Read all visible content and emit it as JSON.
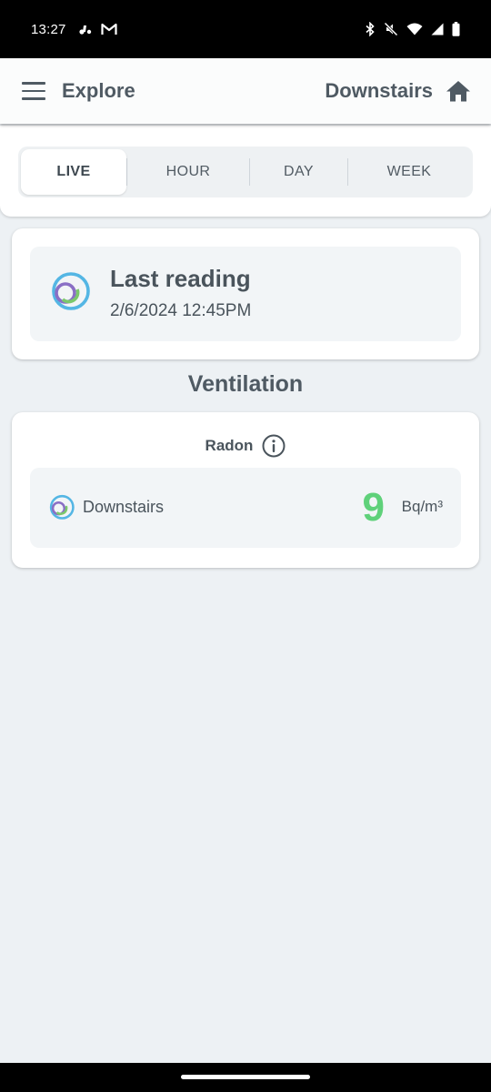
{
  "status_bar": {
    "time": "13:27",
    "left_icons": [
      "notification-dots-icon",
      "gmail-icon"
    ],
    "right_icons": [
      "bluetooth-icon",
      "mute-icon",
      "wifi-icon",
      "signal-icon",
      "battery-icon"
    ]
  },
  "app_bar": {
    "title": "Explore",
    "location": "Downstairs"
  },
  "tabs": [
    {
      "label": "LIVE",
      "active": true
    },
    {
      "label": "HOUR",
      "active": false
    },
    {
      "label": "DAY",
      "active": false
    },
    {
      "label": "WEEK",
      "active": false
    }
  ],
  "last_reading": {
    "title": "Last reading",
    "timestamp": "2/6/2024 12:45PM"
  },
  "section": {
    "title": "Ventilation"
  },
  "radon": {
    "label": "Radon",
    "device": "Downstairs",
    "value": "9",
    "unit": "Bq/m³",
    "value_color": "#5fd17a"
  }
}
